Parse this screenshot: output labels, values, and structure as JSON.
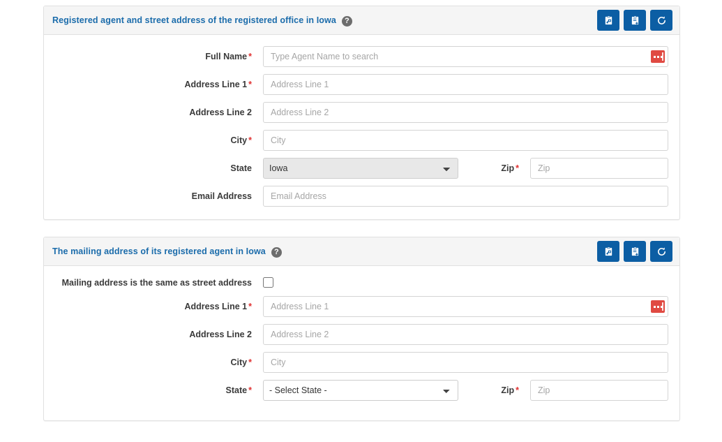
{
  "panels": [
    {
      "title": "Registered agent and street address of the registered office in Iowa",
      "help_icon": "help-circle-icon",
      "actions": [
        {
          "name": "copy-from-button",
          "icon": "clipboard-copy-icon"
        },
        {
          "name": "paste-to-button",
          "icon": "clipboard-paste-icon"
        },
        {
          "name": "reset-button",
          "icon": "refresh-icon"
        }
      ],
      "fields": {
        "full_name": {
          "label": "Full Name",
          "required": true,
          "placeholder": "Type Agent Name to search",
          "value": "",
          "addon_icon": "address-lookup-icon"
        },
        "address_line_1": {
          "label": "Address Line 1",
          "required": true,
          "placeholder": "Address Line 1",
          "value": ""
        },
        "address_line_2": {
          "label": "Address Line 2",
          "required": false,
          "placeholder": "Address Line 2",
          "value": ""
        },
        "city": {
          "label": "City",
          "required": true,
          "placeholder": "City",
          "value": ""
        },
        "state": {
          "label": "State",
          "required": false,
          "selected": "Iowa",
          "readonly": true,
          "options": [
            "Iowa"
          ]
        },
        "zip": {
          "label": "Zip",
          "required": true,
          "placeholder": "Zip",
          "value": ""
        },
        "email": {
          "label": "Email Address",
          "required": false,
          "placeholder": "Email Address",
          "value": ""
        }
      }
    },
    {
      "title": "The mailing address of its registered agent in Iowa",
      "help_icon": "help-circle-icon",
      "actions": [
        {
          "name": "copy-from-button",
          "icon": "clipboard-copy-icon"
        },
        {
          "name": "paste-to-button",
          "icon": "clipboard-paste-icon"
        },
        {
          "name": "reset-button",
          "icon": "refresh-icon"
        }
      ],
      "fields": {
        "same_as_street": {
          "label": "Mailing address is the same as street address",
          "checked": false
        },
        "address_line_1": {
          "label": "Address Line 1",
          "required": true,
          "placeholder": "Address Line 1",
          "value": "",
          "addon_icon": "address-lookup-icon"
        },
        "address_line_2": {
          "label": "Address Line 2",
          "required": false,
          "placeholder": "Address Line 2",
          "value": ""
        },
        "city": {
          "label": "City",
          "required": true,
          "placeholder": "City",
          "value": ""
        },
        "state": {
          "label": "State",
          "required": true,
          "selected": "- Select State -",
          "readonly": false,
          "options": [
            "- Select State -"
          ]
        },
        "zip": {
          "label": "Zip",
          "required": true,
          "placeholder": "Zip",
          "value": ""
        }
      }
    }
  ],
  "colors": {
    "panel_title": "#1b6cab",
    "button_blue": "#0c5ea4",
    "required_red": "#e03131",
    "addon_red": "#e04a42",
    "header_bg": "#f5f5f5"
  },
  "symbols": {
    "required_marker": "*",
    "help_glyph": "?"
  }
}
